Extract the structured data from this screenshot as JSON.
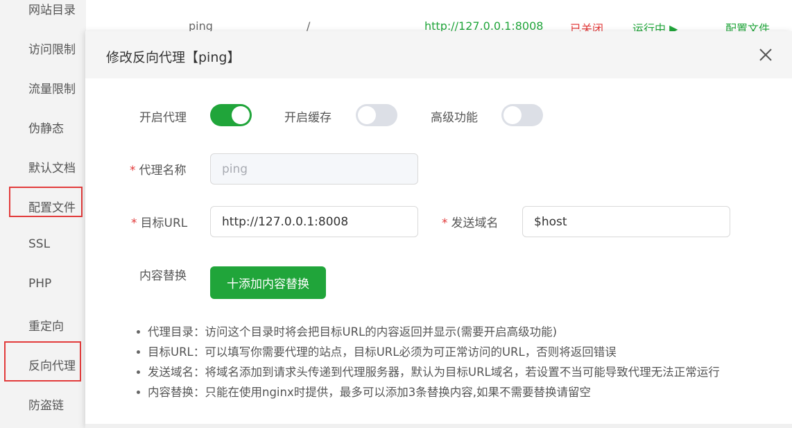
{
  "sidebar": {
    "items": [
      {
        "label": "网站目录"
      },
      {
        "label": "访问限制"
      },
      {
        "label": "流量限制"
      },
      {
        "label": "伪静态"
      },
      {
        "label": "默认文档"
      },
      {
        "label": "配置文件"
      },
      {
        "label": "SSL"
      },
      {
        "label": "PHP"
      },
      {
        "label": "重定向"
      },
      {
        "label": "反向代理"
      },
      {
        "label": "防盗链"
      }
    ]
  },
  "bg_row": {
    "name": "ping",
    "path": "/",
    "url": "http://127.0.0.1:8008",
    "cache_status": "已关闭",
    "run_status": "运行中 ▶",
    "action": "配置文件"
  },
  "modal": {
    "title": "修改反向代理【ping】",
    "toggles": {
      "proxy_label": "开启代理",
      "proxy_on": true,
      "cache_label": "开启缓存",
      "cache_on": false,
      "advanced_label": "高级功能",
      "advanced_on": false
    },
    "fields": {
      "required_mark": "*",
      "name_label": "代理名称",
      "name_value": "ping",
      "target_label": "目标URL",
      "target_value": "http://127.0.0.1:8008",
      "domain_label": "发送域名",
      "domain_value": "$host",
      "replace_label": "内容替换"
    },
    "add_button": "十添加内容替换",
    "tips": [
      "代理目录：访问这个目录时将会把目标URL的内容返回并显示(需要开启高级功能)",
      "目标URL：可以填写你需要代理的站点，目标URL必须为可正常访问的URL，否则将返回错误",
      "发送域名：将域名添加到请求头传递到代理服务器，默认为目标URL域名，若设置不当可能导致代理无法正常运行",
      "内容替换：只能在使用nginx时提供，最多可以添加3条替换内容,如果不需要替换请留空"
    ]
  },
  "colors": {
    "accent": "#20a53a",
    "highlight": "#e23a3a"
  }
}
